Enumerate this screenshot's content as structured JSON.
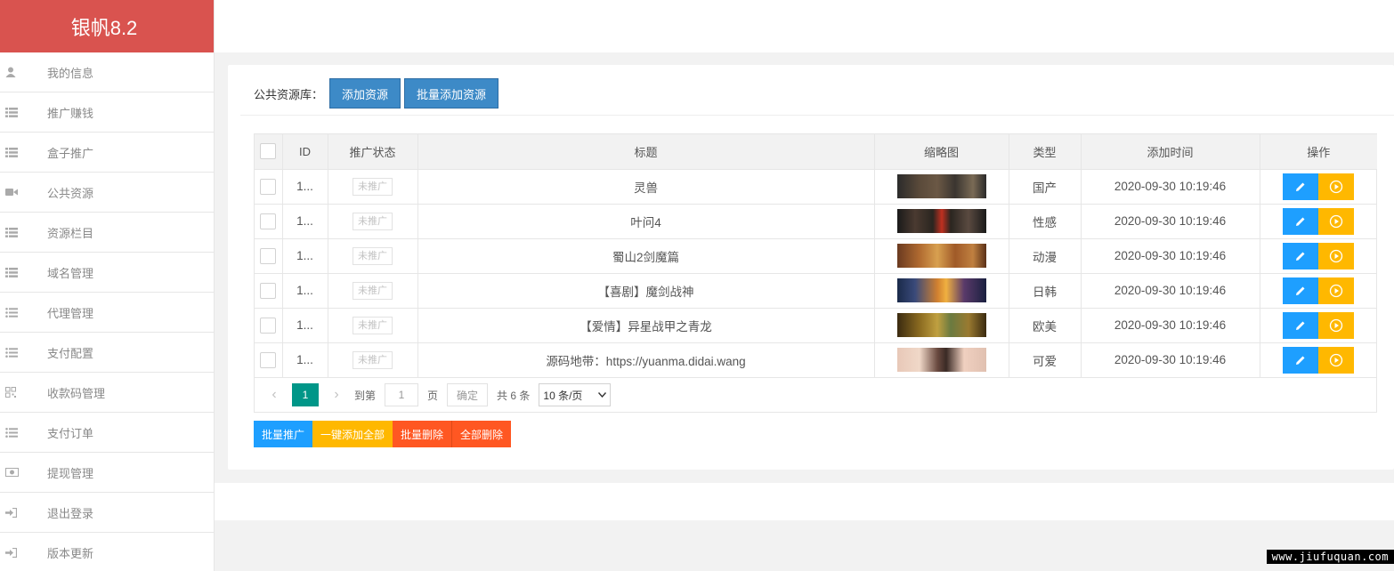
{
  "app": {
    "title": "银帆8.2"
  },
  "sidebar": {
    "items": [
      {
        "label": "我的信息",
        "icon": "user-icon"
      },
      {
        "label": "推广赚钱",
        "icon": "list-icon"
      },
      {
        "label": "盒子推广",
        "icon": "list-icon"
      },
      {
        "label": "公共资源",
        "icon": "video-camera-icon"
      },
      {
        "label": "资源栏目",
        "icon": "list-icon"
      },
      {
        "label": "域名管理",
        "icon": "list-icon"
      },
      {
        "label": "代理管理",
        "icon": "list-ul-icon"
      },
      {
        "label": "支付配置",
        "icon": "list-ul-icon"
      },
      {
        "label": "收款码管理",
        "icon": "qrcode-icon"
      },
      {
        "label": "支付订单",
        "icon": "list-ul-icon"
      },
      {
        "label": "提现管理",
        "icon": "money-icon"
      },
      {
        "label": "退出登录",
        "icon": "sign-in-icon"
      },
      {
        "label": "版本更新",
        "icon": "sign-in-icon"
      }
    ]
  },
  "toolbar": {
    "label": "公共资源库：",
    "add_label": "添加资源",
    "batch_add_label": "批量添加资源"
  },
  "table": {
    "headers": {
      "id": "ID",
      "status": "推广状态",
      "title": "标题",
      "thumb": "缩略图",
      "type": "类型",
      "time": "添加时间",
      "ops": "操作"
    },
    "rows": [
      {
        "id": "1...",
        "status": "未推广",
        "title": "灵兽",
        "type": "国产",
        "time": "2020-09-30 10:19:46"
      },
      {
        "id": "1...",
        "status": "未推广",
        "title": "叶问4",
        "type": "性感",
        "time": "2020-09-30 10:19:46"
      },
      {
        "id": "1...",
        "status": "未推广",
        "title": "蜀山2剑魔篇",
        "type": "动漫",
        "time": "2020-09-30 10:19:46"
      },
      {
        "id": "1...",
        "status": "未推广",
        "title": "【喜剧】魔剑战神",
        "type": "日韩",
        "time": "2020-09-30 10:19:46"
      },
      {
        "id": "1...",
        "status": "未推广",
        "title": "【爱情】异星战甲之青龙",
        "type": "欧美",
        "time": "2020-09-30 10:19:46"
      },
      {
        "id": "1...",
        "status": "未推广",
        "title": "源码地带：https://yuanma.didai.wang",
        "type": "可爱",
        "time": "2020-09-30 10:19:46"
      }
    ]
  },
  "pager": {
    "current": "1",
    "goto_label": "到第",
    "page_input": "1",
    "page_unit": "页",
    "confirm": "确定",
    "total": "共 6 条",
    "per_page": "10 条/页"
  },
  "bottom_buttons": {
    "batch_promote": "批量推广",
    "add_all": "一键添加全部",
    "batch_delete": "批量删除",
    "delete_all": "全部删除"
  },
  "watermark": "www.jiufuquan.com",
  "colors": {
    "logo_bg": "#d9534f",
    "primary_blue": "#3d8ac7",
    "edit_blue": "#1e9fff",
    "play_yellow": "#ffb800",
    "pager_teal": "#009688",
    "danger_orange": "#ff5722"
  }
}
